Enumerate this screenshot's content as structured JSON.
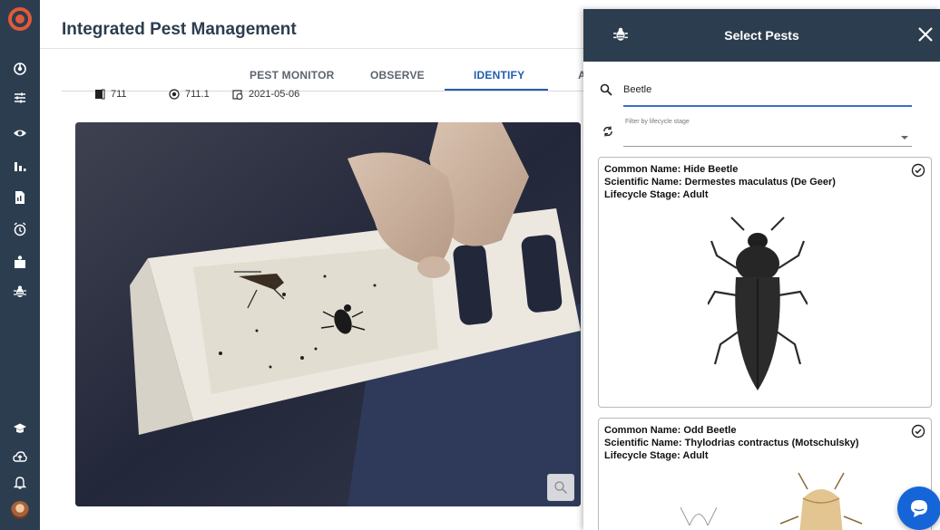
{
  "app": {
    "title": "Integrated Pest Management"
  },
  "sidebar": {
    "items": [
      {
        "icon": "monitor-icon"
      },
      {
        "icon": "sliders-icon"
      },
      {
        "icon": "eye-icon"
      },
      {
        "icon": "bar-chart-icon"
      },
      {
        "icon": "report-icon"
      },
      {
        "icon": "alarm-clock-icon"
      },
      {
        "icon": "box-icon"
      },
      {
        "icon": "bug-icon"
      }
    ],
    "bottom_items": [
      {
        "icon": "graduation-cap-icon"
      },
      {
        "icon": "cloud-upload-icon"
      },
      {
        "icon": "bell-icon"
      }
    ]
  },
  "tabs": [
    {
      "label": "PEST MONITOR",
      "active": false
    },
    {
      "label": "OBSERVE",
      "active": false
    },
    {
      "label": "IDENTIFY",
      "active": true
    },
    {
      "label": "A",
      "active": false
    }
  ],
  "meta": {
    "room": "711",
    "trap": "711.1",
    "date": "2021-05-06"
  },
  "panel": {
    "title": "Select Pests",
    "search_value": "Beetle",
    "filter_label": "Filter by lifecycle stage",
    "filter_value": ""
  },
  "pests": [
    {
      "common_name": "Common Name: Hide Beetle",
      "scientific_name": "Scientific Name: Dermestes maculatus (De Geer)",
      "lifecycle": "Lifecycle Stage: Adult"
    },
    {
      "common_name": "Common Name: Odd Beetle",
      "scientific_name": "Scientific Name: Thylodrias contractus (Motschulsky)",
      "lifecycle": "Lifecycle Stage: Adult"
    }
  ],
  "colors": {
    "sidebar": "#2c3d4f",
    "accent": "#1e5fb3",
    "brand": "#e05a3a",
    "chat": "#1565d8"
  }
}
